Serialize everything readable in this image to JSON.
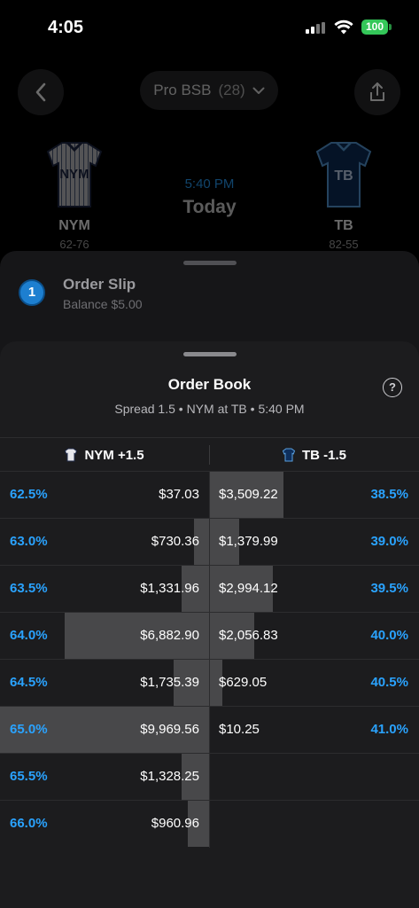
{
  "status_bar": {
    "time": "4:05",
    "battery": "100",
    "colors": {
      "battery": "#34c759"
    }
  },
  "header": {
    "league": "Pro BSB",
    "league_count": "(28)",
    "back_icon": "chevron-left-icon",
    "share_icon": "share-icon",
    "dropdown_icon": "chevron-down-icon"
  },
  "matchup": {
    "away": {
      "abbr": "NYM",
      "record": "62-76",
      "jersey_text": "NYM",
      "jersey_color": "#c9c9cc"
    },
    "home": {
      "abbr": "TB",
      "record": "82-55",
      "jersey_text": "TB",
      "jersey_color": "#0e2f5c"
    },
    "time": "5:40 PM",
    "day": "Today"
  },
  "order_slip": {
    "step": "1",
    "title": "Order Slip",
    "balance": "Balance $5.00"
  },
  "order_book": {
    "title": "Order Book",
    "subtitle": "Spread 1.5 • NYM at TB • 5:40 PM",
    "help_icon": "question-circle-icon",
    "columns": {
      "left": "NYM +1.5",
      "right": "TB -1.5"
    },
    "accent_color": "#2aa3ff",
    "rows": [
      {
        "bid_prob": "62.5%",
        "bid_amt": "$37.03",
        "bid_fill": 0.0,
        "ask_amt": "$3,509.22",
        "ask_fill": 0.35,
        "ask_prob": "38.5%"
      },
      {
        "bid_prob": "63.0%",
        "bid_amt": "$730.36",
        "bid_fill": 0.07,
        "ask_amt": "$1,379.99",
        "ask_fill": 0.14,
        "ask_prob": "39.0%"
      },
      {
        "bid_prob": "63.5%",
        "bid_amt": "$1,331.96",
        "bid_fill": 0.13,
        "ask_amt": "$2,994.12",
        "ask_fill": 0.3,
        "ask_prob": "39.5%"
      },
      {
        "bid_prob": "64.0%",
        "bid_amt": "$6,882.90",
        "bid_fill": 0.69,
        "ask_amt": "$2,056.83",
        "ask_fill": 0.21,
        "ask_prob": "40.0%"
      },
      {
        "bid_prob": "64.5%",
        "bid_amt": "$1,735.39",
        "bid_fill": 0.17,
        "ask_amt": "$629.05",
        "ask_fill": 0.06,
        "ask_prob": "40.5%"
      },
      {
        "bid_prob": "65.0%",
        "bid_amt": "$9,969.56",
        "bid_fill": 1.0,
        "ask_amt": "$10.25",
        "ask_fill": 0.0,
        "ask_prob": "41.0%"
      },
      {
        "bid_prob": "65.5%",
        "bid_amt": "$1,328.25",
        "bid_fill": 0.13,
        "ask_amt": "",
        "ask_fill": 0.0,
        "ask_prob": ""
      },
      {
        "bid_prob": "66.0%",
        "bid_amt": "$960.96",
        "bid_fill": 0.1,
        "ask_amt": "",
        "ask_fill": 0.0,
        "ask_prob": ""
      }
    ]
  }
}
